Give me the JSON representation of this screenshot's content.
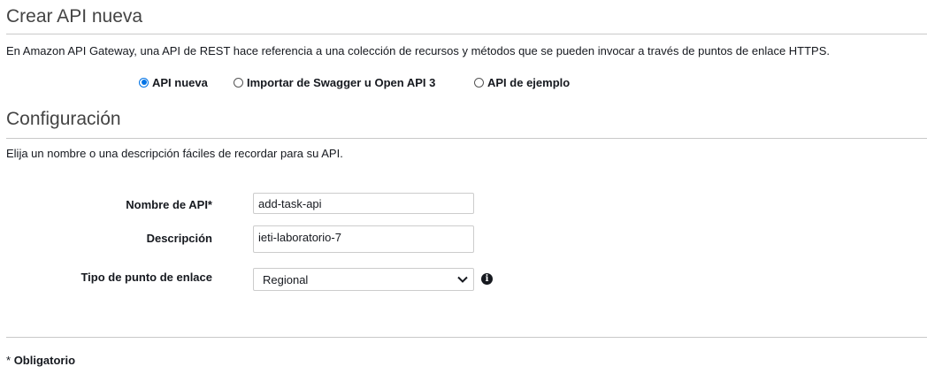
{
  "create_section": {
    "title": "Crear API nueva",
    "description": "En Amazon API Gateway, una API de REST hace referencia a una colección de recursos y métodos que se pueden invocar a través de puntos de enlace HTTPS.",
    "options": [
      {
        "label": "API nueva",
        "selected": true
      },
      {
        "label": "Importar de Swagger u Open API 3",
        "selected": false
      },
      {
        "label": "API de ejemplo",
        "selected": false
      }
    ]
  },
  "config_section": {
    "title": "Configuración",
    "description": "Elija un nombre o una descripción fáciles de recordar para su API.",
    "api_name": {
      "label": "Nombre de API*",
      "value": "add-task-api"
    },
    "description_field": {
      "label": "Descripción",
      "value": "ieti-laboratorio-7"
    },
    "endpoint_type": {
      "label": "Tipo de punto de enlace",
      "value": "Regional",
      "info_icon": "info-icon"
    }
  },
  "footer": {
    "required_marker": "*",
    "required_label": "Obligatorio"
  }
}
